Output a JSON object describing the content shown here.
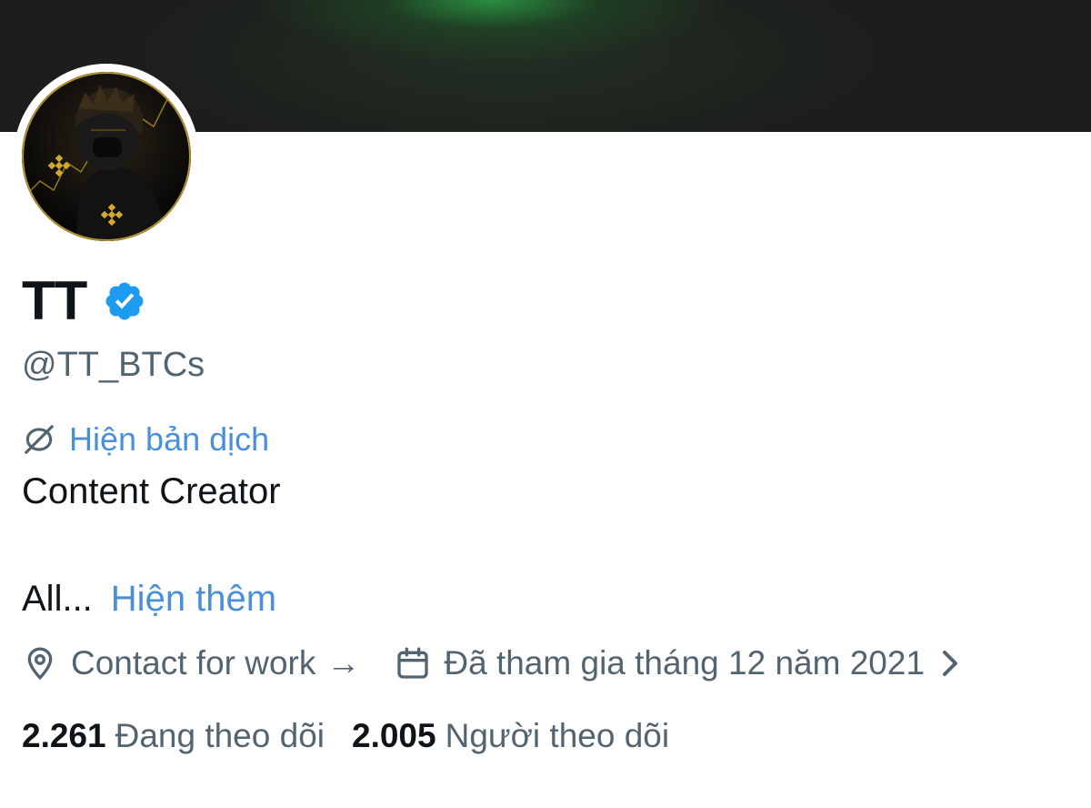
{
  "profile": {
    "display_name": "TT",
    "handle": "@TT_BTCs",
    "verified_icon": "verified-badge-icon",
    "translate_link": "Hiện bản dịch",
    "bio_line": "Content Creator",
    "bio_truncated": "All...",
    "show_more_link": "Hiện thêm",
    "location": "Contact for work",
    "location_arrow": "→",
    "joined": "Đã tham gia tháng 12 năm 2021",
    "following_count": "2.261",
    "following_label": "Đang theo dõi",
    "followers_count": "2.005",
    "followers_label": "Người theo dõi"
  },
  "colors": {
    "link": "#4a90d9",
    "verified": "#1d9bf0",
    "secondary_text": "#536471",
    "primary_text": "#0f1419",
    "banner_bg": "#1c1e1c",
    "banner_glow": "#2ca046"
  }
}
